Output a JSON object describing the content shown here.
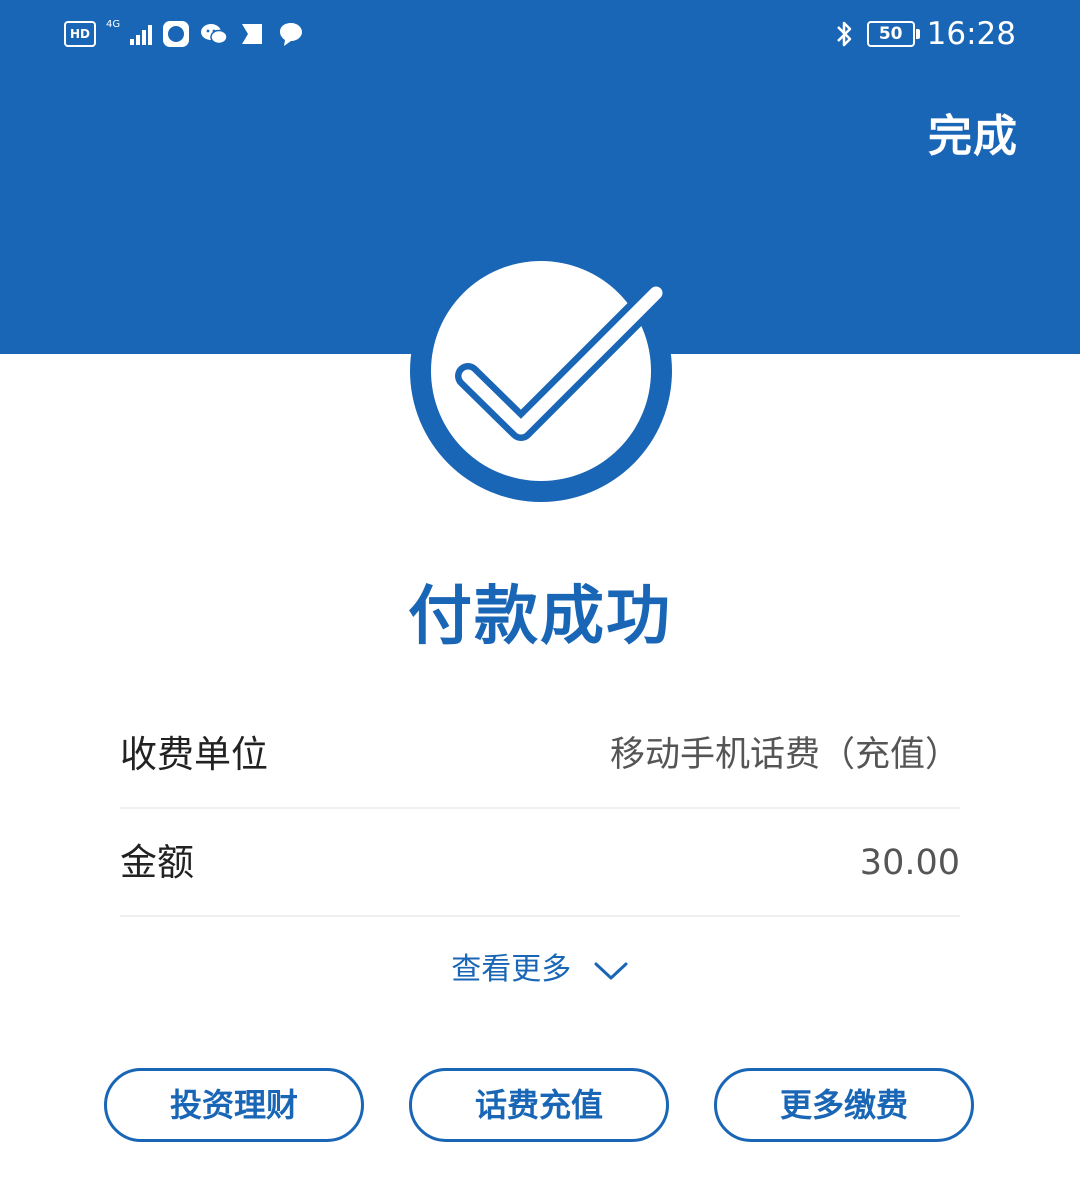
{
  "status_bar": {
    "hd": "HD",
    "network": "4G",
    "battery": "50",
    "time": "16:28",
    "icons": [
      "signal-icon",
      "app-icon",
      "wechat-icon",
      "app-icon",
      "message-icon",
      "bluetooth-icon"
    ]
  },
  "header": {
    "done_label": "完成",
    "color": "#1a66b6"
  },
  "result": {
    "icon": "check-circle-icon",
    "title": "付款成功"
  },
  "details": {
    "rows": [
      {
        "label": "收费单位",
        "value": "移动手机话费（充值）"
      },
      {
        "label": "金额",
        "value": "30.00"
      }
    ],
    "more_label": "查看更多"
  },
  "actions": {
    "buttons": [
      "投资理财",
      "话费充值",
      "更多缴费"
    ]
  }
}
